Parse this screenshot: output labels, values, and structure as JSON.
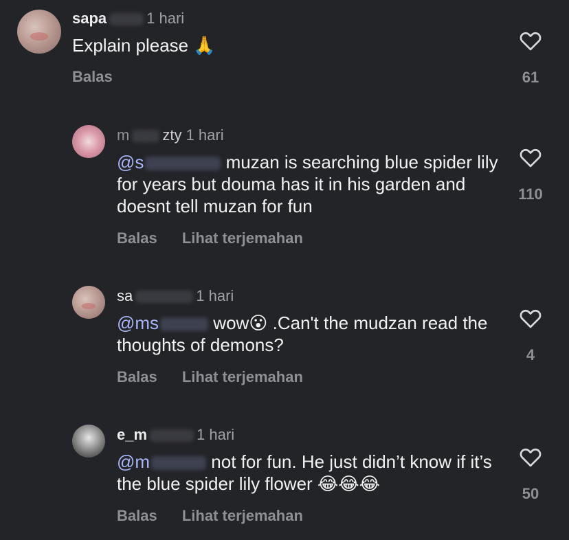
{
  "comments": [
    {
      "username": "sapa",
      "time": "1 hari",
      "text": "Explain please 🙏",
      "reply_label": "Balas",
      "likes": "61",
      "icon": "heart-outline-icon"
    },
    {
      "username": "m",
      "username_tail": "zty",
      "time": "1 hari",
      "mention": "@s",
      "text": "muzan is searching blue spider lily for years but douma has it in his garden and doesnt tell muzan for fun",
      "reply_label": "Balas",
      "translate_label": "Lihat terjemahan",
      "likes": "110",
      "icon": "heart-outline-icon"
    },
    {
      "username": "sa",
      "time": "1 hari",
      "mention": "@ms",
      "text": "wow😮 .Can't the mudzan read the thoughts of demons?",
      "reply_label": "Balas",
      "translate_label": "Lihat terjemahan",
      "likes": "4",
      "icon": "heart-outline-icon"
    },
    {
      "username": "e_m",
      "time": "1 hari",
      "mention": "@m",
      "text": "not for fun.  He just didn’t know if it’s the blue spider lily flower 😂😂😂",
      "reply_label": "Balas",
      "translate_label": "Lihat terjemahan",
      "likes": "50",
      "icon": "heart-outline-icon"
    }
  ],
  "colors": {
    "background": "#232428",
    "mention": "#a7b4f6",
    "secondary_text": "#8e9096"
  }
}
